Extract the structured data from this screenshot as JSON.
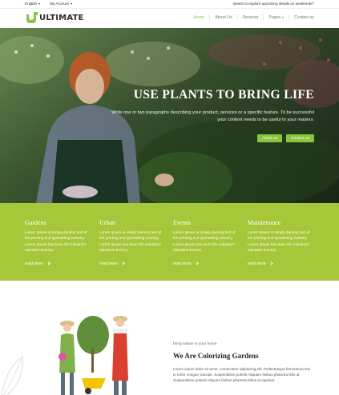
{
  "topbar": {
    "language": "English",
    "account": "My Account",
    "notice": "Wants to explore upcoming details on weekends?"
  },
  "brand": {
    "name": "ULTIMATE",
    "accent": "#8bc53f"
  },
  "nav": {
    "items": [
      {
        "label": "Home",
        "active": true
      },
      {
        "label": "About Us",
        "active": false
      },
      {
        "label": "Services",
        "active": false
      },
      {
        "label": "Pages",
        "active": false,
        "dropdown": true
      },
      {
        "label": "Contact us",
        "active": false
      }
    ]
  },
  "hero": {
    "title": "USE PLANTS TO BRING LIFE",
    "subtitle": "Write one or two paragraphs describing your product, services or a specific feature. To be successful your content needs to be useful to your readers.",
    "primary_button": "About us",
    "secondary_button": "Contact us"
  },
  "features": {
    "band_color": "#a6c73a",
    "items": [
      {
        "title": "Gardens",
        "text": "Lorem Ipsum is simply dummy text of the printing and typesetting industry. Lorem Ipsum has been the industry's standard dummy.",
        "more": "read more"
      },
      {
        "title": "Urban",
        "text": "Lorem Ipsum is simply dummy text of the printing and typesetting industry. Lorem Ipsum has been the industry's standard dummy.",
        "more": "read more"
      },
      {
        "title": "Events",
        "text": "Lorem Ipsum is simply dummy text of the printing and typesetting industry. Lorem Ipsum has been the industry's standard dummy.",
        "more": "read more"
      },
      {
        "title": "Maintenance",
        "text": "Lorem Ipsum is simply dummy text of the printing and typesetting industry. Lorem Ipsum has been the industry's standard dummy.",
        "more": "read more"
      }
    ]
  },
  "about": {
    "eyebrow": "bring nature in your home",
    "heading": "We Are Colorizing Gardens",
    "text": "Lorem ipsum dolor sit amet, consectetur adipiscing elit. Pellentesque fermentum Est in tortor congue suscipit. Suspendisse potenti Aliquam finibus pharetra felis at Suspendisse potenti Aliquam finibus pharetra tellus at egestas."
  }
}
